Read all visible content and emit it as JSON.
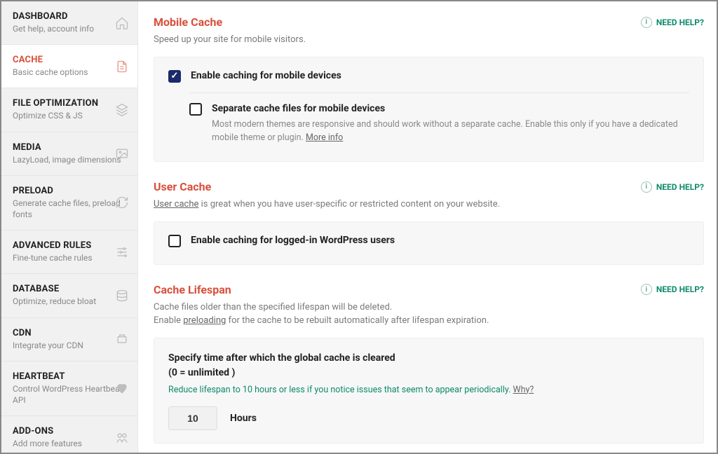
{
  "sidebar": {
    "items": [
      {
        "title": "DASHBOARD",
        "desc": "Get help, account info",
        "icon": "home"
      },
      {
        "title": "CACHE",
        "desc": "Basic cache options",
        "icon": "document"
      },
      {
        "title": "FILE OPTIMIZATION",
        "desc": "Optimize CSS & JS",
        "icon": "layers"
      },
      {
        "title": "MEDIA",
        "desc": "LazyLoad, image dimensions",
        "icon": "image"
      },
      {
        "title": "PRELOAD",
        "desc": "Generate cache files, preload fonts",
        "icon": "refresh"
      },
      {
        "title": "ADVANCED RULES",
        "desc": "Fine-tune cache rules",
        "icon": "sliders"
      },
      {
        "title": "DATABASE",
        "desc": "Optimize, reduce bloat",
        "icon": "database"
      },
      {
        "title": "CDN",
        "desc": "Integrate your CDN",
        "icon": "cdn"
      },
      {
        "title": "HEARTBEAT",
        "desc": "Control WordPress Heartbeat API",
        "icon": "heartbeat"
      },
      {
        "title": "ADD-ONS",
        "desc": "Add more features",
        "icon": "addons"
      }
    ]
  },
  "help_label": "NEED HELP?",
  "mobile_cache": {
    "title": "Mobile Cache",
    "desc": "Speed up your site for mobile visitors.",
    "opt1_label": "Enable caching for mobile devices",
    "opt2_label": "Separate cache files for mobile devices",
    "opt2_desc": "Most modern themes are responsive and should work without a separate cache. Enable this only if you have a dedicated mobile theme or plugin. ",
    "more_info": "More info"
  },
  "user_cache": {
    "title": "User Cache",
    "link_text": "User cache",
    "desc_rest": " is great when you have user-specific or restricted content on your website.",
    "opt1_label": "Enable caching for logged-in WordPress users"
  },
  "lifespan": {
    "title": "Cache Lifespan",
    "desc_line1": "Cache files older than the specified lifespan will be deleted.",
    "desc_line2_pre": "Enable ",
    "preloading_link": "preloading",
    "desc_line2_post": " for the cache to be rebuilt automatically after lifespan expiration.",
    "field_label_l1": "Specify time after which the global cache is cleared",
    "field_label_l2": "(0 = unlimited )",
    "tip_pre": "Reduce lifespan to 10 hours or less if you notice issues that seem to appear periodically. ",
    "tip_link": "Why?",
    "value": "10",
    "unit": "Hours"
  }
}
